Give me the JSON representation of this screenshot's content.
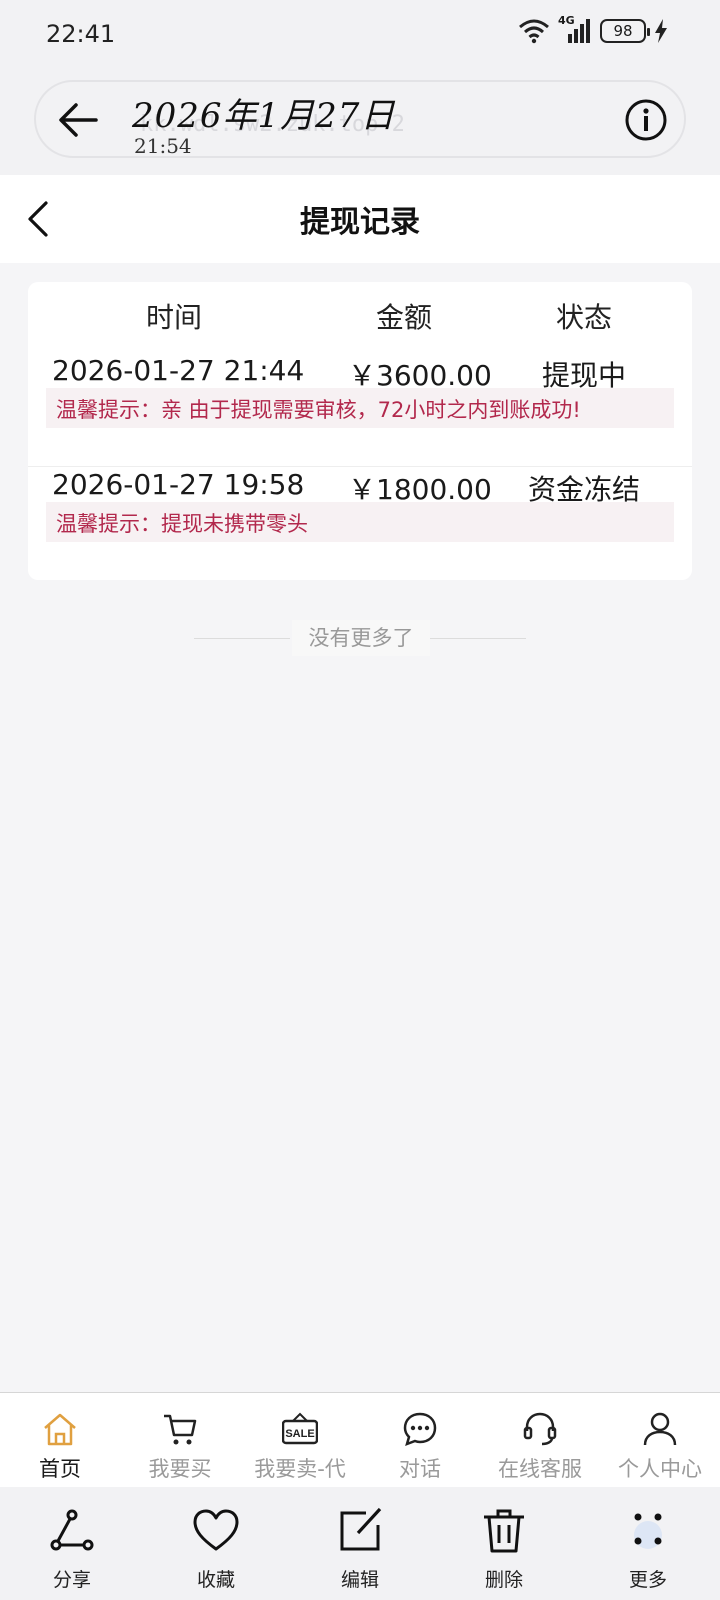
{
  "status_bar": {
    "time": "22:41",
    "network": "4G",
    "battery": "98"
  },
  "annotation": {
    "url": "kk.wdl.sw2.zuk.top-2",
    "handwritten_date": "2026年1月27日",
    "handwritten_time": "21:54"
  },
  "header": {
    "title": "提现记录"
  },
  "table": {
    "columns": [
      "时间",
      "金额",
      "状态"
    ],
    "rows": [
      {
        "time": "2026-01-27 21:44",
        "amount": "￥3600.00",
        "status": "提现中",
        "tip": "温馨提示：亲 由于提现需要审核，72小时之内到账成功!"
      },
      {
        "time": "2026-01-27 19:58",
        "amount": "￥1800.00",
        "status": "资金冻结",
        "tip": "温馨提示：提现未携带零头"
      }
    ]
  },
  "no_more": "没有更多了",
  "tabbar": {
    "items": [
      {
        "label": "首页",
        "icon": "home-icon",
        "active": true
      },
      {
        "label": "我要买",
        "icon": "cart-icon"
      },
      {
        "label": "我要卖-代",
        "icon": "sale-sign-icon",
        "icon_text": "SALE"
      },
      {
        "label": "对话",
        "icon": "chat-bubble-icon"
      },
      {
        "label": "在线客服",
        "icon": "headset-icon"
      },
      {
        "label": "个人中心",
        "icon": "person-icon"
      }
    ]
  },
  "toolbar": {
    "items": [
      {
        "label": "分享",
        "icon": "share-icon"
      },
      {
        "label": "收藏",
        "icon": "heart-icon"
      },
      {
        "label": "编辑",
        "icon": "edit-icon"
      },
      {
        "label": "删除",
        "icon": "trash-icon"
      },
      {
        "label": "更多",
        "icon": "more-dots-icon"
      }
    ]
  },
  "colors": {
    "accent_home": "#e0a040",
    "tip_text": "#b2284c",
    "tip_bg": "#f7f1f3"
  }
}
